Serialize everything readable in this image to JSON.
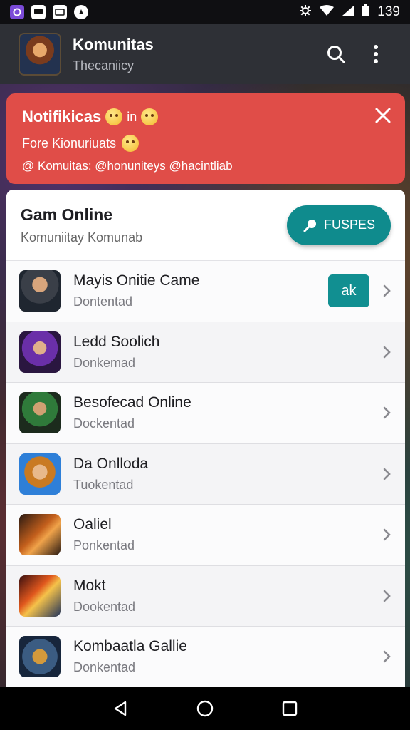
{
  "status_bar": {
    "time": "139",
    "left_icons": [
      "notification-app-icon",
      "chat-icon",
      "tablet-icon",
      "compass-icon"
    ],
    "right_icons": [
      "settings-icon",
      "wifi-icon",
      "signal-icon",
      "battery-icon"
    ]
  },
  "app_bar": {
    "title": "Komunitas",
    "subtitle": "Thecaniicy"
  },
  "notification": {
    "title": "Notifikicas",
    "title_suffix": "in",
    "line": "Fore Kionuriuats",
    "mentions": "@ Komuitas: @honunitеys @hacintliab",
    "color": "#e04d48"
  },
  "card": {
    "title": "Gam Online",
    "subtitle": "Komuniitay Komunab",
    "action_label": "FUSPES",
    "accent": "#0f8b8d"
  },
  "games": [
    {
      "title": "Mayis Onitie Came",
      "subtitle": "Dontentad",
      "badge": "ak",
      "thumb": "warrior-thumb"
    },
    {
      "title": "Ledd Soolich",
      "subtitle": "Donkemad",
      "badge": "",
      "thumb": "sorcerer-thumb"
    },
    {
      "title": "Besofecad Online",
      "subtitle": "Dockentad",
      "badge": "",
      "thumb": "knight-thumb"
    },
    {
      "title": "Da Onlloda",
      "subtitle": "Tuokentad",
      "badge": "",
      "thumb": "hero-thumb"
    },
    {
      "title": "Oaliel",
      "subtitle": "Ponkentad",
      "badge": "",
      "thumb": "cannon-thumb"
    },
    {
      "title": "Mokt",
      "subtitle": "Dookentad",
      "badge": "",
      "thumb": "battle-thumb"
    },
    {
      "title": "Kombaatla Gallie",
      "subtitle": "Donkentad",
      "badge": "",
      "thumb": "galley-thumb"
    }
  ]
}
